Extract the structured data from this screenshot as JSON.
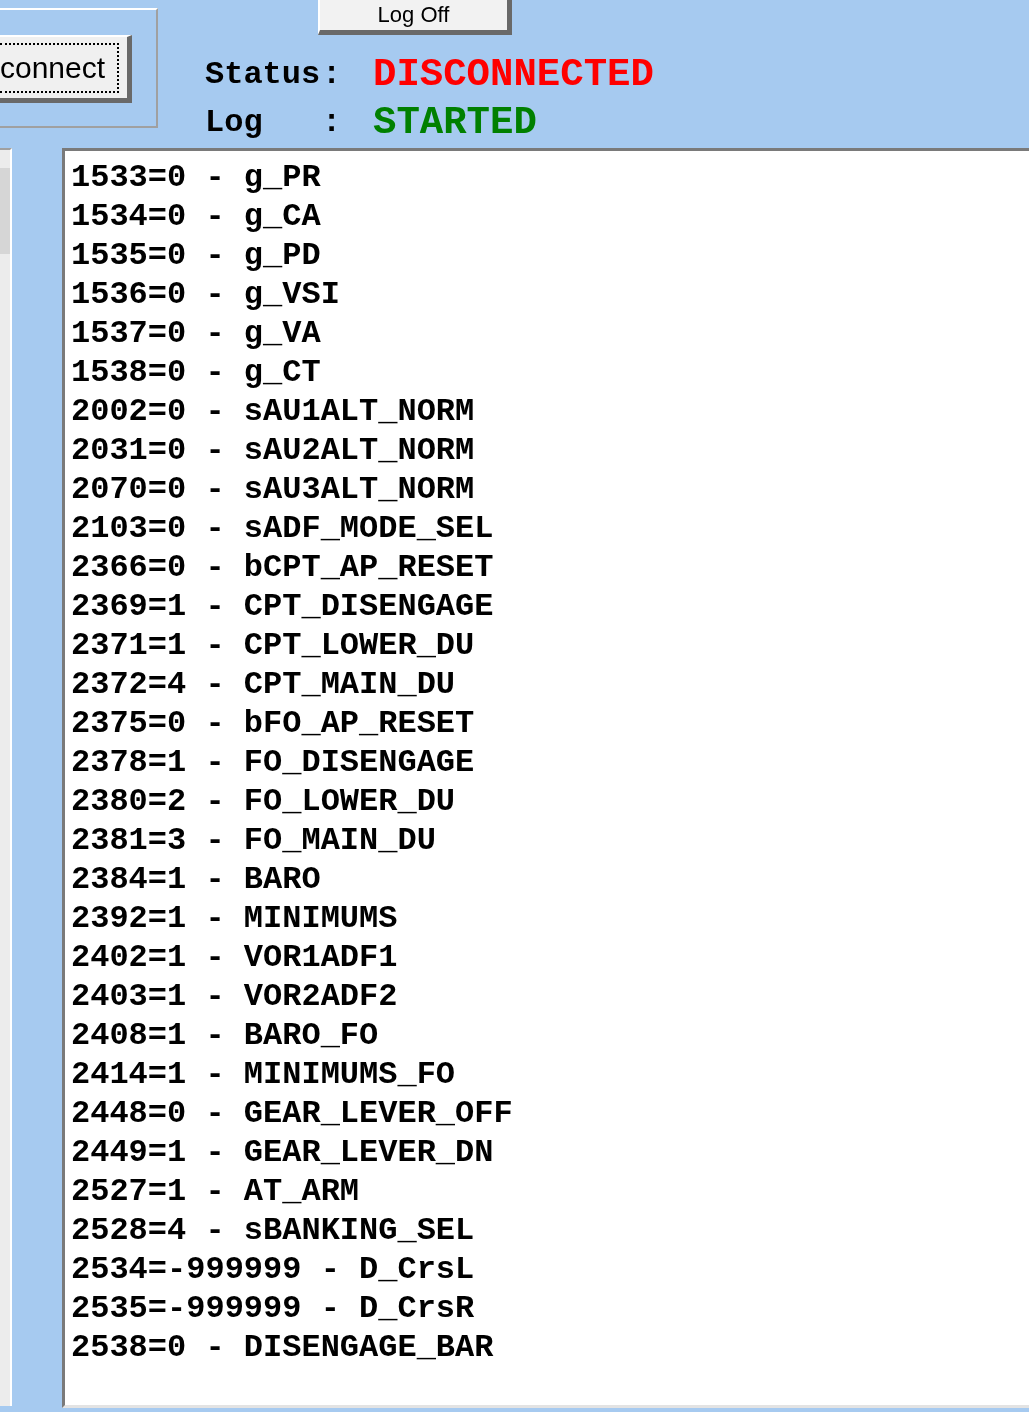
{
  "connection_group": {
    "button": "connect"
  },
  "log_off_button": "Log Off",
  "status_rows": [
    {
      "label": "Status",
      "separator": ":",
      "value": "DISCONNECTED",
      "color": "#ff0000"
    },
    {
      "label": "Log",
      "separator": ":",
      "value": "STARTED",
      "color": "#008000"
    }
  ],
  "log_list": {
    "lines": [
      "1533=0 - g_PR",
      "1534=0 - g_CA",
      "1535=0 - g_PD",
      "1536=0 - g_VSI",
      "1537=0 - g_VA",
      "1538=0 - g_CT",
      "2002=0 - sAU1ALT_NORM",
      "2031=0 - sAU2ALT_NORM",
      "2070=0 - sAU3ALT_NORM",
      "2103=0 - sADF_MODE_SEL",
      "2366=0 - bCPT_AP_RESET",
      "2369=1 - CPT_DISENGAGE",
      "2371=1 - CPT_LOWER_DU",
      "2372=4 - CPT_MAIN_DU",
      "2375=0 - bFO_AP_RESET",
      "2378=1 - FO_DISENGAGE",
      "2380=2 - FO_LOWER_DU",
      "2381=3 - FO_MAIN_DU",
      "2384=1 - BARO",
      "2392=1 - MINIMUMS",
      "2402=1 - VOR1ADF1",
      "2403=1 - VOR2ADF2",
      "2408=1 - BARO_FO",
      "2414=1 - MINIMUMS_FO",
      "2448=0 - GEAR_LEVER_OFF",
      "2449=1 - GEAR_LEVER_DN",
      "2527=1 - AT_ARM",
      "2528=4 - sBANKING_SEL",
      "2534=-999999 - D_CrsL",
      "2535=-999999 - D_CrsR",
      "2538=0 - DISENGAGE_BAR"
    ]
  }
}
